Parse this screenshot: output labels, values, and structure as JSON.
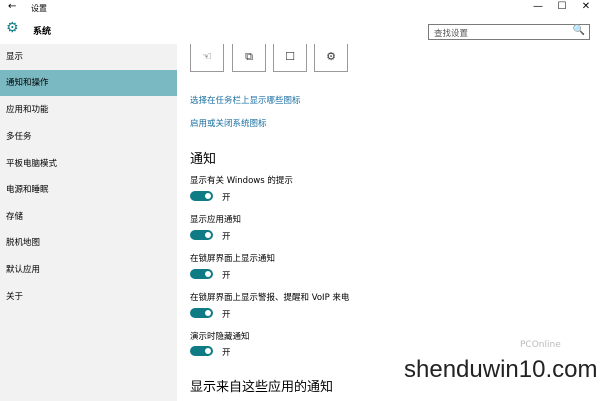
{
  "window": {
    "title": "设置",
    "back_icon": "back-arrow-icon"
  },
  "window_controls": {
    "minimize": "—",
    "maximize": "☐",
    "close": "✕"
  },
  "header": {
    "breadcrumb": "系统",
    "search_placeholder": "查找设置",
    "search_icon": "🔍"
  },
  "sidebar": {
    "items": [
      {
        "label": "显示"
      },
      {
        "label": "通知和操作",
        "active": true
      },
      {
        "label": "应用和功能"
      },
      {
        "label": "多任务"
      },
      {
        "label": "平板电脑模式"
      },
      {
        "label": "电源和睡眠"
      },
      {
        "label": "存储"
      },
      {
        "label": "脱机地图"
      },
      {
        "label": "默认应用"
      },
      {
        "label": "关于"
      }
    ]
  },
  "quick_actions": [
    "☜",
    "⧉",
    "☐",
    "⚙"
  ],
  "links": {
    "taskbar_icons": "选择在任务栏上显示哪些图标",
    "system_icons": "启用或关闭系统图标"
  },
  "notifications": {
    "heading": "通知",
    "settings": [
      {
        "label": "显示有关 Windows 的提示",
        "state": "开"
      },
      {
        "label": "显示应用通知",
        "state": "开"
      },
      {
        "label": "在锁屏界面上显示通知",
        "state": "开"
      },
      {
        "label": "在锁屏界面上显示警报、提醒和 VoIP 来电",
        "state": "开"
      },
      {
        "label": "演示时隐藏通知",
        "state": "开"
      }
    ]
  },
  "apps_heading": "显示来自这些应用的通知",
  "watermark": {
    "text": "shenduwin10.com"
  },
  "colors": {
    "accent": "#0f7c85",
    "sidebar_active": "#7ab9c2",
    "link": "#1a6fa1"
  }
}
